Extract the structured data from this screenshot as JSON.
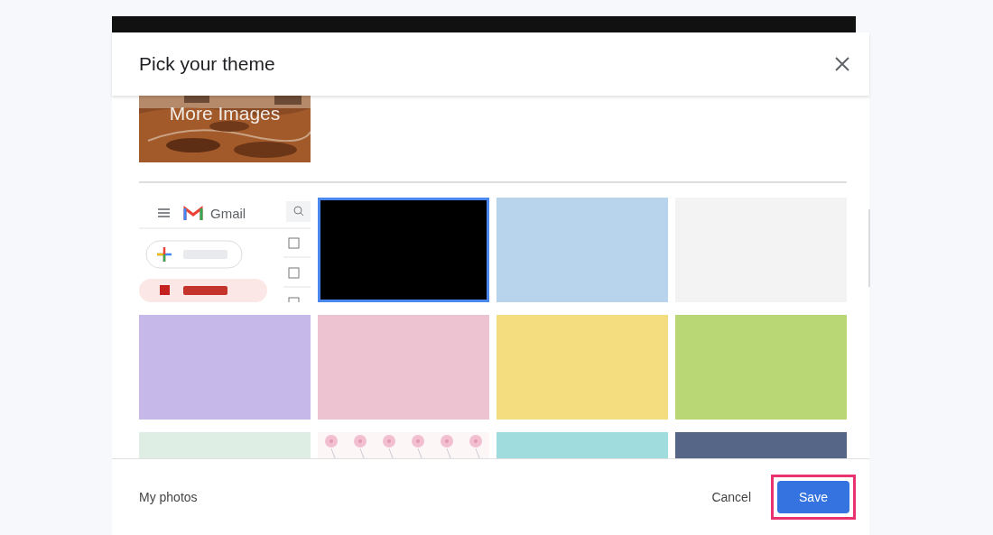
{
  "dialog": {
    "title": "Pick your theme"
  },
  "more_images": {
    "label": "More Images"
  },
  "themes": [
    {
      "kind": "preview",
      "selected": false,
      "app_name": "Gmail"
    },
    {
      "kind": "color",
      "color": "#000000",
      "selected": true
    },
    {
      "kind": "color",
      "color": "#b8d4ec",
      "selected": false
    },
    {
      "kind": "color",
      "color": "#f3f3f3",
      "selected": false
    },
    {
      "kind": "color",
      "color": "#c6b8e8",
      "selected": false
    },
    {
      "kind": "color",
      "color": "#edc2d1",
      "selected": false
    },
    {
      "kind": "color",
      "color": "#f3dd7f",
      "selected": false
    },
    {
      "kind": "color",
      "color": "#b9d774",
      "selected": false
    },
    {
      "kind": "color",
      "color": "#dfeee4",
      "selected": false
    },
    {
      "kind": "pattern",
      "selected": false
    },
    {
      "kind": "color",
      "color": "#a0dbde",
      "selected": false
    },
    {
      "kind": "color",
      "color": "#556687",
      "selected": false
    }
  ],
  "footer": {
    "my_photos": "My photos",
    "cancel": "Cancel",
    "save": {
      "label": "Save",
      "highlighted": true
    }
  }
}
